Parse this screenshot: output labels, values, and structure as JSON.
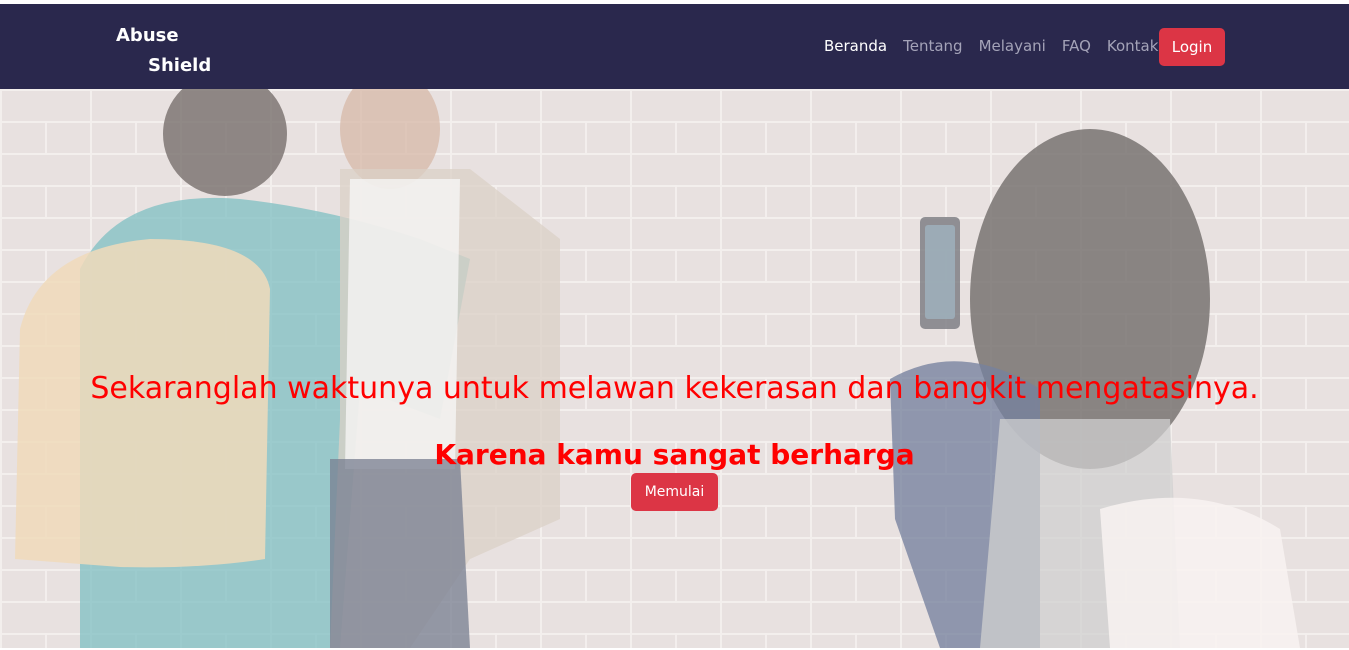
{
  "brand": {
    "line1": "Abuse",
    "line2": "Shield"
  },
  "nav": {
    "items": [
      {
        "label": "Beranda",
        "active": true
      },
      {
        "label": "Tentang",
        "active": false
      },
      {
        "label": "Melayani",
        "active": false
      },
      {
        "label": "FAQ",
        "active": false
      },
      {
        "label": "Kontak",
        "active": false
      }
    ],
    "login_label": "Login"
  },
  "hero": {
    "headline": "Sekaranglah waktunya untuk melawan kekerasan dan bangkit mengatasinya.",
    "subline": "Karena kamu sangat berharga",
    "cta_label": "Memulai"
  },
  "colors": {
    "navbar": "#2a284d",
    "accent": "#dc3545",
    "hero_text": "#ff0000"
  }
}
